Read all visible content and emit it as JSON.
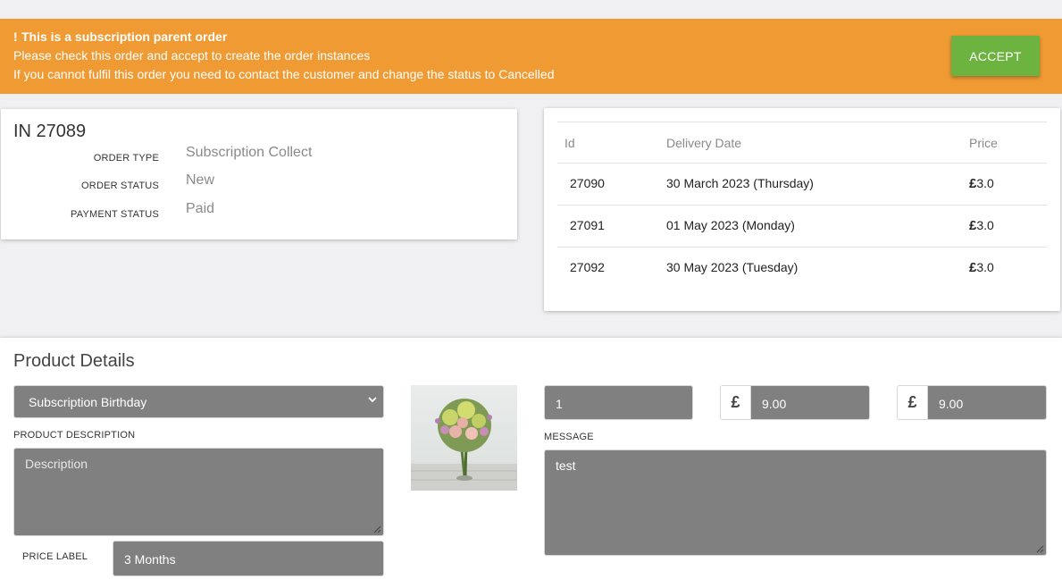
{
  "banner": {
    "icon": "exclamation-icon",
    "icon_glyph": "!",
    "title": "This is a subscription parent order",
    "line1": "Please check this order and accept to create the order instances",
    "line2": "If you cannot fulfil this order you need to contact the customer and change the status to Cancelled",
    "accept_label": "ACCEPT",
    "color": "#f09a33",
    "accept_color": "#6db33f"
  },
  "order": {
    "number": "IN 27089",
    "fields": [
      {
        "label": "ORDER TYPE",
        "value": "Subscription Collect"
      },
      {
        "label": "ORDER STATUS",
        "value": "New"
      },
      {
        "label": "PAYMENT STATUS",
        "value": "Paid"
      }
    ]
  },
  "instances": {
    "headers": {
      "id": "Id",
      "date": "Delivery Date",
      "price": "Price"
    },
    "currency_symbol": "£",
    "rows": [
      {
        "id": "27090",
        "date": "30 March 2023 (Thursday)",
        "price": "3.0"
      },
      {
        "id": "27091",
        "date": "01 May 2023 (Monday)",
        "price": "3.0"
      },
      {
        "id": "27092",
        "date": "30 May 2023 (Tuesday)",
        "price": "3.0"
      }
    ]
  },
  "product": {
    "title": "Product Details",
    "selected_product": "Subscription Birthday",
    "description_label": "PRODUCT DESCRIPTION",
    "description_placeholder": "Description",
    "price_label_label": "PRICE LABEL",
    "price_label_value": "3 Months",
    "quantity": "1",
    "currency_symbol": "£",
    "unit_price": "9.00",
    "total_price": "9.00",
    "message_label": "MESSAGE",
    "message_value": "test",
    "image_icon": "flower-bouquet-image"
  }
}
